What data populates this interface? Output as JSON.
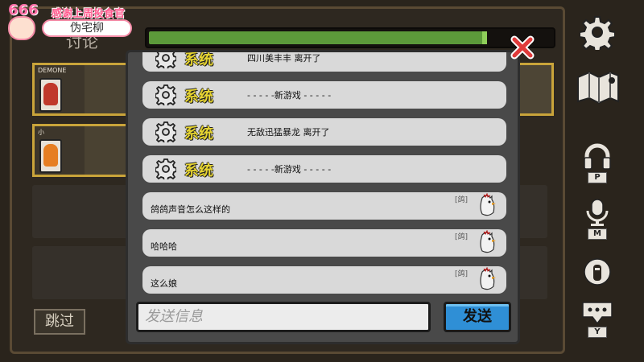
{
  "overlay": {
    "badge_number": "666",
    "thanks_text": "感谢上周投食官",
    "name_pill": "伪宅柳"
  },
  "background": {
    "title": "讨论",
    "players": [
      {
        "name": "DEMONE"
      },
      {
        "name": "小"
      }
    ],
    "skip_label": "跳过"
  },
  "progress": {
    "fill_fraction": 0.84
  },
  "chat": {
    "messages": [
      {
        "kind": "system",
        "label": "系统",
        "text": "四川美丰丰 离开了"
      },
      {
        "kind": "system",
        "label": "系统",
        "text": "- - - - -新游戏 - - - - -"
      },
      {
        "kind": "system",
        "label": "系统",
        "text": "无敌迅猛暴龙 离开了"
      },
      {
        "kind": "system",
        "label": "系统",
        "text": "- - - - -新游戏 - - - - -"
      },
      {
        "kind": "user",
        "text": "鸽鸽声音怎么这样的",
        "tag": "[鸽]"
      },
      {
        "kind": "user",
        "text": "哈哈哈",
        "tag": "[鸽]"
      },
      {
        "kind": "user",
        "text": "这么娘",
        "tag": "[鸽]"
      }
    ],
    "input_placeholder": "发送信息",
    "send_label": "发送"
  },
  "sidebar": {
    "buttons": [
      {
        "icon": "gear-icon",
        "key": ""
      },
      {
        "icon": "map-icon",
        "key": ""
      },
      {
        "icon": "headphones-icon",
        "key": "P"
      },
      {
        "icon": "microphone-icon",
        "key": "M"
      },
      {
        "icon": "character-icon",
        "key": ""
      },
      {
        "icon": "chat-bubble-icon",
        "key": "Y"
      }
    ]
  },
  "colors": {
    "system_label": "#e6d431",
    "send_button": "#2f8fd6",
    "close_x": "#e03a3a",
    "progress_fill": "#5c9a3a",
    "player_card_border": "#c9a43a"
  }
}
